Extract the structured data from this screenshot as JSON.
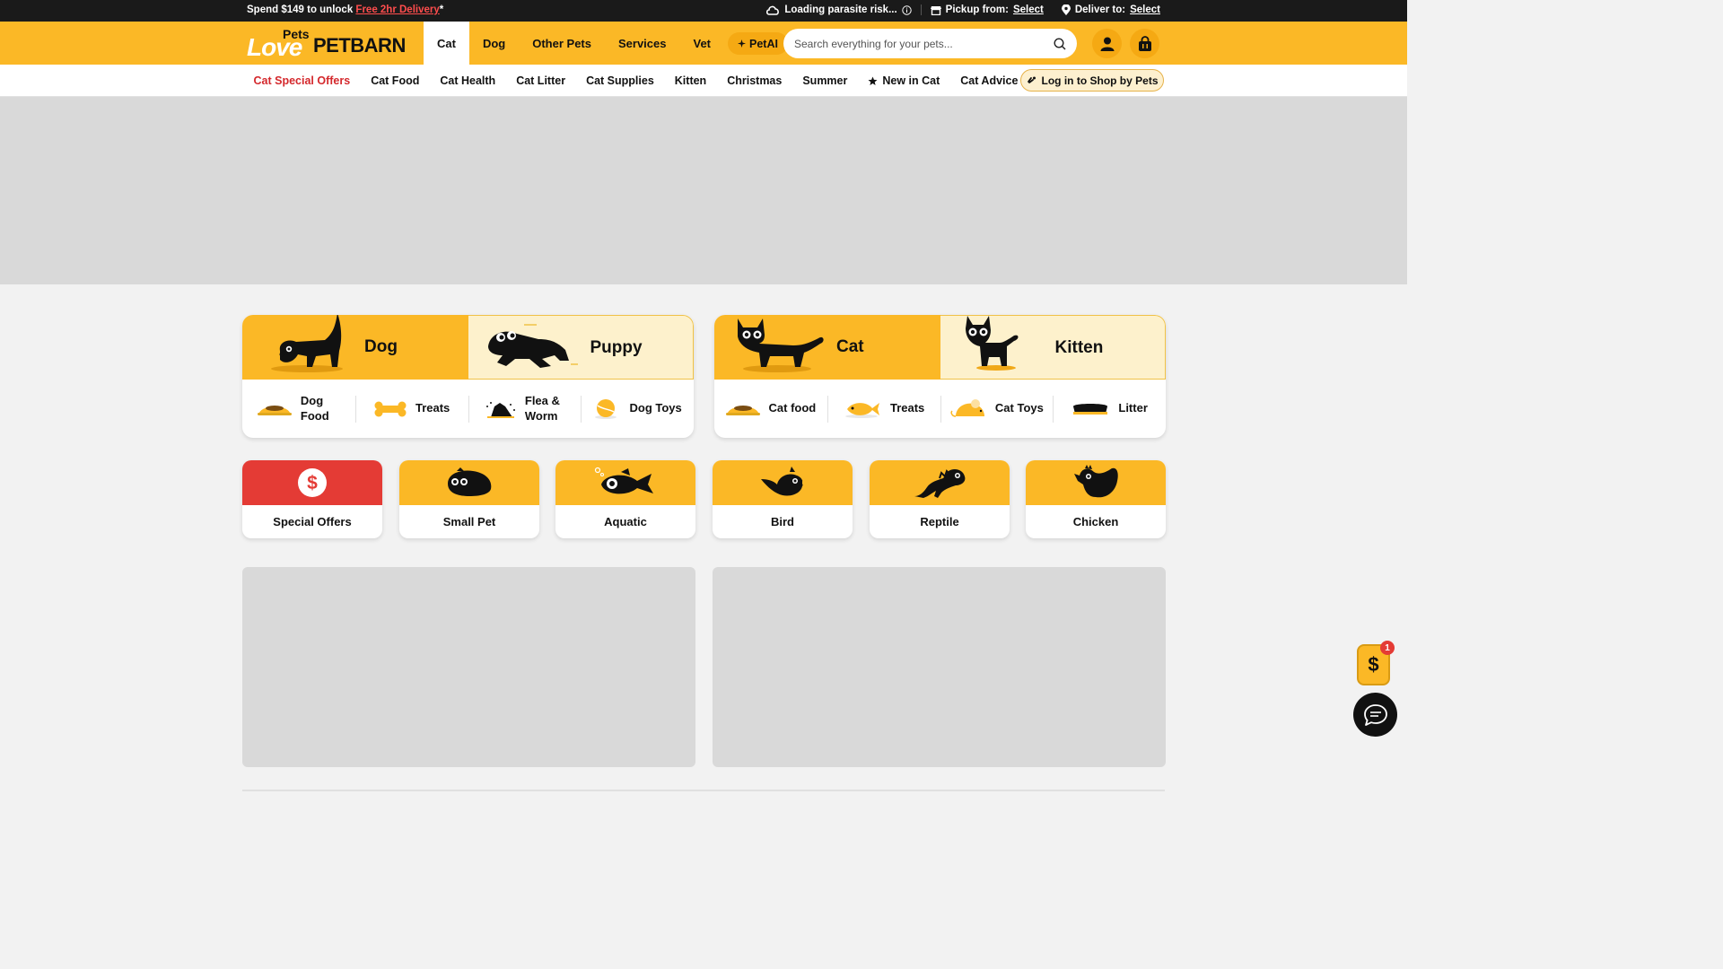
{
  "topbar": {
    "promo_prefix": "Spend $149 to unlock ",
    "promo_link": "Free 2hr Delivery",
    "promo_suffix": "*",
    "parasite_text": "Loading parasite risk...",
    "pickup_label": "Pickup from:",
    "pickup_link": "Select",
    "deliver_label": "Deliver to:",
    "deliver_link": "Select"
  },
  "header": {
    "logo_love": "Love",
    "logo_pets": "Pets",
    "logo_petbarn": "PETBARN",
    "nav": [
      "Cat",
      "Dog",
      "Other Pets",
      "Services",
      "Vet"
    ],
    "active_nav": "Cat",
    "petai_label": "PetAI",
    "search_placeholder": "Search everything for your pets..."
  },
  "subnav": {
    "links": [
      "Cat Special Offers",
      "Cat Food",
      "Cat Health",
      "Cat Litter",
      "Cat Supplies",
      "Kitten",
      "Christmas",
      "Summer",
      "New in Cat",
      "Cat Advice"
    ],
    "shop_by_pets": "Log in to Shop by Pets"
  },
  "cards": [
    {
      "primary": "Dog",
      "secondary": "Puppy",
      "subs": [
        {
          "label": "Dog Food",
          "icon": "food-bowl-icon"
        },
        {
          "label": "Treats",
          "icon": "bone-treat-icon"
        },
        {
          "label": "Flea & Worm",
          "icon": "flea-icon"
        },
        {
          "label": "Dog Toys",
          "icon": "ball-toy-icon"
        }
      ]
    },
    {
      "primary": "Cat",
      "secondary": "Kitten",
      "subs": [
        {
          "label": "Cat food",
          "icon": "food-bowl-icon"
        },
        {
          "label": "Treats",
          "icon": "fish-treat-icon"
        },
        {
          "label": "Cat Toys",
          "icon": "mouse-toy-icon"
        },
        {
          "label": "Litter",
          "icon": "litter-tray-icon"
        }
      ]
    }
  ],
  "tiles": [
    {
      "label": "Special Offers",
      "icon": "dollar-icon"
    },
    {
      "label": "Small Pet",
      "icon": "guinea-pig-icon"
    },
    {
      "label": "Aquatic",
      "icon": "fish-icon"
    },
    {
      "label": "Bird",
      "icon": "bird-icon"
    },
    {
      "label": "Reptile",
      "icon": "lizard-icon"
    },
    {
      "label": "Chicken",
      "icon": "chicken-icon"
    }
  ],
  "floating": {
    "dollar_symbol": "$",
    "badge_count": "1"
  },
  "colors": {
    "brand_yellow": "#fbb826",
    "accent_red": "#d4282c",
    "dark": "#1a1a1a"
  }
}
